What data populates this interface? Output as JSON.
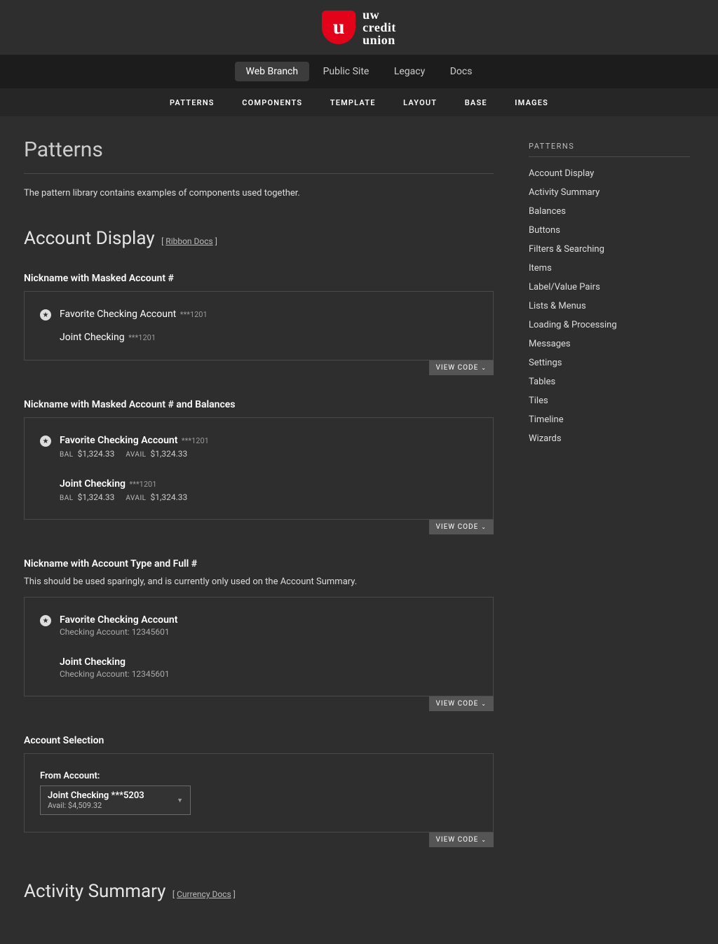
{
  "logo": {
    "mark": "u",
    "line1": "uw",
    "line2": "credit",
    "line3": "union"
  },
  "tabs": [
    {
      "label": "Web Branch",
      "active": true
    },
    {
      "label": "Public Site",
      "active": false
    },
    {
      "label": "Legacy",
      "active": false
    },
    {
      "label": "Docs",
      "active": false
    }
  ],
  "subnav": [
    "Patterns",
    "Components",
    "Template",
    "Layout",
    "Base",
    "Images"
  ],
  "page": {
    "title": "Patterns",
    "intro": "The pattern library contains examples of components used together."
  },
  "account_display": {
    "heading": "Account Display",
    "doclink": "Ribbon Docs",
    "sections": {
      "masked": {
        "title": "Nickname with Masked Account #",
        "items": [
          {
            "fav": true,
            "name": "Favorite Checking Account",
            "mask": "***1201"
          },
          {
            "fav": false,
            "name": "Joint Checking",
            "mask": "***1201"
          }
        ]
      },
      "masked_bal": {
        "title": "Nickname with Masked Account # and Balances",
        "items": [
          {
            "fav": true,
            "name": "Favorite Checking Account",
            "mask": "***1201",
            "bal": "$1,324.33",
            "avail": "$1,324.33"
          },
          {
            "fav": false,
            "name": "Joint Checking",
            "mask": "***1201",
            "bal": "$1,324.33",
            "avail": "$1,324.33"
          }
        ],
        "labels": {
          "bal": "BAL",
          "avail": "AVAIL"
        }
      },
      "type_full": {
        "title": "Nickname with Account Type and Full #",
        "desc": "This should be used sparingly, and is currently only used on the Account Summary.",
        "items": [
          {
            "fav": true,
            "name": "Favorite Checking Account",
            "sub": "Checking Account: 12345601"
          },
          {
            "fav": false,
            "name": "Joint Checking",
            "sub": "Checking Account: 12345601"
          }
        ]
      },
      "selection": {
        "title": "Account Selection",
        "label": "From Account:",
        "selected": {
          "name": "Joint Checking ***5203",
          "avail": "Avail: $4,509.32"
        }
      }
    }
  },
  "activity_summary": {
    "heading": "Activity Summary",
    "doclink": "Currency Docs"
  },
  "viewcode": "VIEW CODE",
  "sidebar": {
    "title": "PATTERNS",
    "items": [
      "Account Display",
      "Activity Summary",
      "Balances",
      "Buttons",
      "Filters & Searching",
      "Items",
      "Label/Value Pairs",
      "Lists & Menus",
      "Loading & Processing",
      "Messages",
      "Settings",
      "Tables",
      "Tiles",
      "Timeline",
      "Wizards"
    ]
  }
}
